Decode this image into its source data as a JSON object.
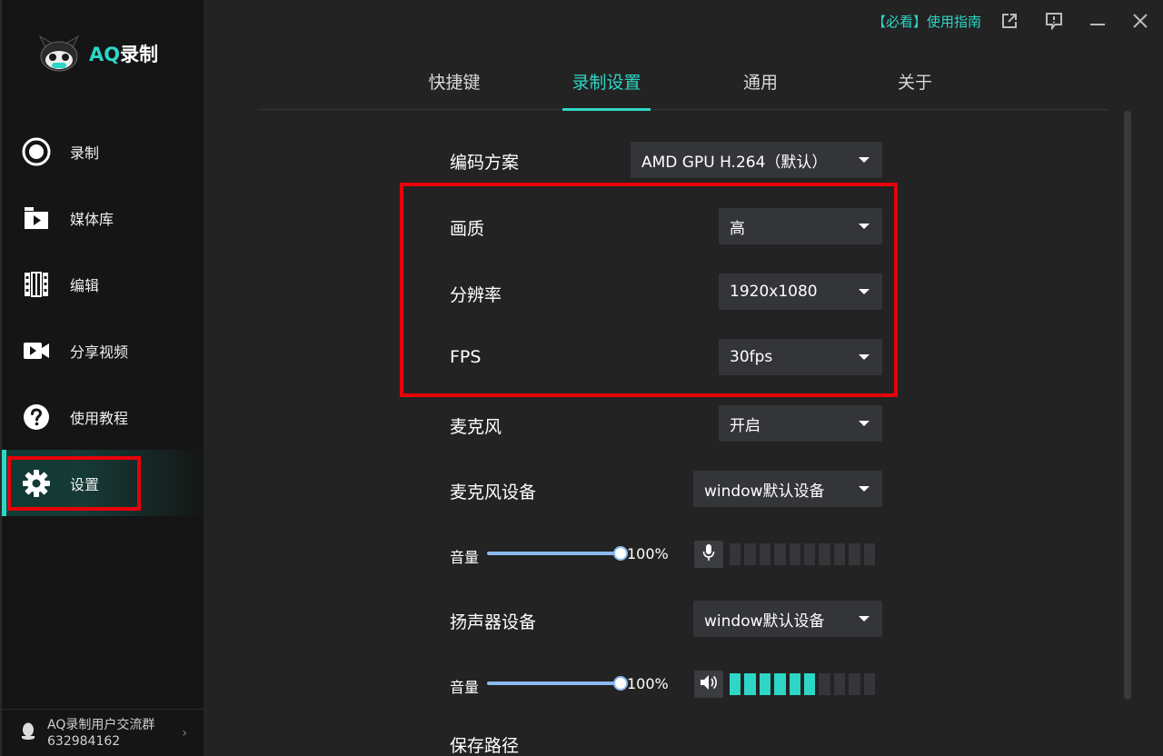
{
  "app": {
    "logo_prefix": "AQ",
    "logo_suffix": "录制"
  },
  "sidebar": {
    "items": [
      {
        "label": "录制",
        "icon": "record-icon"
      },
      {
        "label": "媒体库",
        "icon": "media-library-icon"
      },
      {
        "label": "编辑",
        "icon": "edit-film-icon"
      },
      {
        "label": "分享视频",
        "icon": "video-camera-icon"
      },
      {
        "label": "使用教程",
        "icon": "help-icon"
      },
      {
        "label": "设置",
        "icon": "gear-icon",
        "active": true
      }
    ],
    "footer": {
      "line1": "AQ录制用户交流群",
      "line2": "632984162",
      "icon": "qq-penguin-icon"
    }
  },
  "topbar": {
    "guide_label": "【必看】使用指南"
  },
  "tabs": [
    {
      "label": "快捷键"
    },
    {
      "label": "录制设置",
      "active": true
    },
    {
      "label": "通用"
    },
    {
      "label": "关于"
    }
  ],
  "settings": {
    "encoder": {
      "label": "编码方案",
      "value": "AMD GPU H.264（默认）"
    },
    "quality": {
      "label": "画质",
      "value": "高"
    },
    "resolution": {
      "label": "分辨率",
      "value": "1920x1080"
    },
    "fps": {
      "label": "FPS",
      "value": "30fps"
    },
    "mic": {
      "label": "麦克风",
      "value": "开启"
    },
    "mic_device": {
      "label": "麦克风设备",
      "value": "window默认设备"
    },
    "mic_volume": {
      "label": "音量",
      "value_text": "100%",
      "level": 1.0,
      "meter_on": 0,
      "meter_total": 10
    },
    "speaker_device": {
      "label": "扬声器设备",
      "value": "window默认设备"
    },
    "speaker_volume": {
      "label": "音量",
      "value_text": "100%",
      "level": 1.0,
      "meter_on": 6,
      "meter_total": 10
    },
    "save_path": {
      "label": "保存路径"
    }
  },
  "colors": {
    "accent": "#2ed6c6",
    "highlight": "#e8000b",
    "slider": "#8ab8f0"
  }
}
